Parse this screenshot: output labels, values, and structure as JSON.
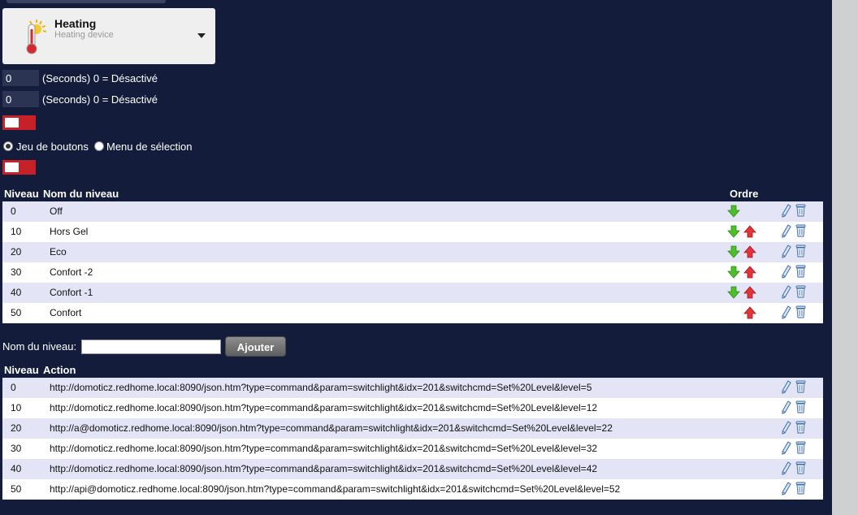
{
  "device": {
    "name": "Heating",
    "subtitle": "Heating device"
  },
  "delays": [
    {
      "value": "0",
      "hint": "(Seconds) 0 = Désactivé"
    },
    {
      "value": "0",
      "hint": "(Seconds) 0 = Désactivé"
    }
  ],
  "style_options": {
    "buttons_label": "Jeu de boutons",
    "menu_label": "Menu de sélection",
    "selected": "buttons"
  },
  "levels_table": {
    "headers": {
      "level": "Niveau",
      "name": "Nom du niveau",
      "order": "Ordre"
    },
    "rows": [
      {
        "level": "0",
        "name": "Off",
        "down": true,
        "up": false
      },
      {
        "level": "10",
        "name": "Hors Gel",
        "down": true,
        "up": true
      },
      {
        "level": "20",
        "name": "Eco",
        "down": true,
        "up": true
      },
      {
        "level": "30",
        "name": "Confort -2",
        "down": true,
        "up": true
      },
      {
        "level": "40",
        "name": "Confort -1",
        "down": true,
        "up": true
      },
      {
        "level": "50",
        "name": "Confort",
        "down": false,
        "up": true
      }
    ]
  },
  "add_level": {
    "label": "Nom du niveau:",
    "value": "",
    "button": "Ajouter"
  },
  "actions_table": {
    "headers": {
      "level": "Niveau",
      "action": "Action"
    },
    "rows": [
      {
        "level": "0",
        "action": "http://domoticz.redhome.local:8090/json.htm?type=command&param=switchlight&idx=201&switchcmd=Set%20Level&level=5"
      },
      {
        "level": "10",
        "action": "http://domoticz.redhome.local:8090/json.htm?type=command&param=switchlight&idx=201&switchcmd=Set%20Level&level=12"
      },
      {
        "level": "20",
        "action": "http://a@domoticz.redhome.local:8090/json.htm?type=command&param=switchlight&idx=201&switchcmd=Set%20Level&level=22"
      },
      {
        "level": "30",
        "action": "http://domoticz.redhome.local:8090/json.htm?type=command&param=switchlight&idx=201&switchcmd=Set%20Level&level=32"
      },
      {
        "level": "40",
        "action": "http://domoticz.redhome.local:8090/json.htm?type=command&param=switchlight&idx=201&switchcmd=Set%20Level&level=42"
      },
      {
        "level": "50",
        "action": "http://api@domoticz.redhome.local:8090/json.htm?type=command&param=switchlight&idx=201&switchcmd=Set%20Level&level=52"
      }
    ]
  },
  "icons": {
    "device": "thermometer-sun-icon",
    "down": "arrow-down-icon",
    "up": "arrow-up-icon",
    "edit": "pencil-icon",
    "delete": "trash-icon"
  },
  "colors": {
    "background": "#131d3b",
    "toggle": "#c62128",
    "down_arrow": "#4cbf2a",
    "up_arrow": "#e2333a",
    "row_shade": "#e3e4f5"
  }
}
